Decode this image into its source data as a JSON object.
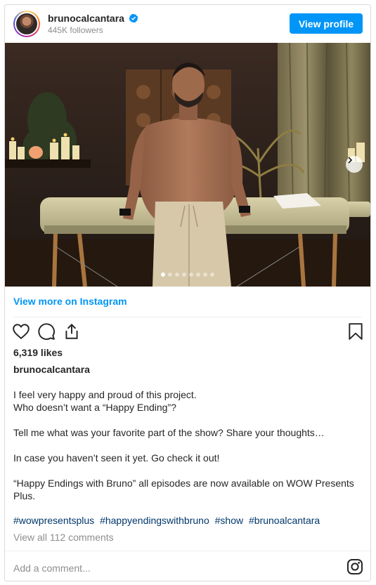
{
  "header": {
    "username": "brunocalcantara",
    "followers": "445K followers",
    "view_profile_label": "View profile"
  },
  "media": {
    "slide_count": 8,
    "active_slide": 1
  },
  "view_more_label": "View more on Instagram",
  "likes": "6,319 likes",
  "caption": {
    "username": "brunocalcantara",
    "lines": [
      "I feel very happy and proud of this project.",
      "Who doesn’t want a “Happy Ending”?",
      "Tell me what was your favorite part of the show? Share your thoughts…",
      "In case you haven’t seen it yet. Go check it out!",
      "“Happy Endings with Bruno” all episodes are now available on WOW Presents",
      "Plus."
    ],
    "hashtags": [
      "#wowpresentsplus",
      "#happyendingswithbruno",
      "#show",
      "#brunoalcantara"
    ]
  },
  "view_comments_label": "View all 112 comments",
  "comment_placeholder": "Add a comment...",
  "icons": {
    "like": "heart-icon",
    "comment": "comment-icon",
    "share": "share-icon",
    "save": "bookmark-icon",
    "brand": "instagram-icon",
    "verified": "verified-badge-icon",
    "next": "chevron-right-icon"
  },
  "colors": {
    "accent": "#0095f6",
    "hashtag": "#00376b",
    "muted": "#8e8e8e"
  }
}
